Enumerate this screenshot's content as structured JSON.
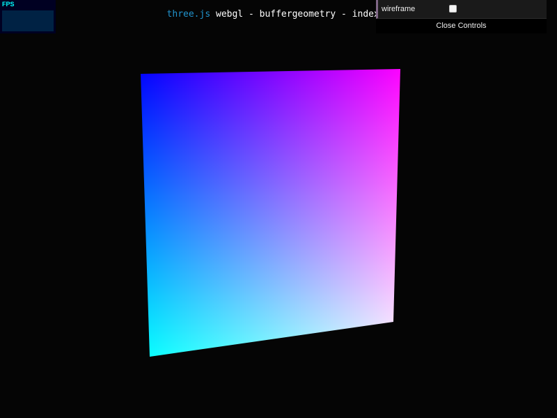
{
  "info": {
    "link_text": "three.js",
    "description": " webgl - buffergeometry - indexed"
  },
  "stats": {
    "label": "FPS"
  },
  "gui": {
    "wireframe_label": "wireframe",
    "wireframe_checked": false,
    "close_label": "Close Controls"
  },
  "colors": {
    "background": "#050505",
    "link": "#2194ce",
    "gradient_top_left": "#0000ff",
    "gradient_top_right": "#ff00ff",
    "gradient_bottom_left": "#00ffff",
    "gradient_bottom_right": "#ffffff"
  }
}
